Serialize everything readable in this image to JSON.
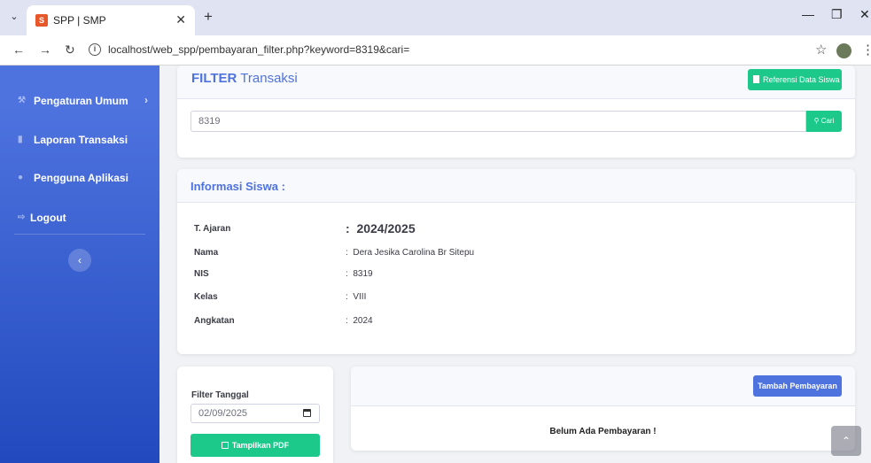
{
  "browser": {
    "tab_title": "SPP | SMP",
    "favicon_text": "S",
    "url": "localhost/web_spp/pembayaran_filter.php?keyword=8319&cari="
  },
  "sidebar": {
    "items": [
      {
        "label": "Pengaturan Umum",
        "icon": "wrench-icon"
      },
      {
        "label": "Laporan Transaksi",
        "icon": "file-icon"
      },
      {
        "label": "Pengguna Aplikasi",
        "icon": "user-icon"
      },
      {
        "label": "Logout",
        "icon": "logout-icon"
      }
    ]
  },
  "filter": {
    "title_bold": "FILTER",
    "title_rest": " Transaksi",
    "reference_button": "Referensi Data Siswa",
    "search_value": "8319",
    "search_button": "Cari"
  },
  "student_info": {
    "title": "Informasi Siswa :",
    "rows": [
      {
        "label": "T. Ajaran",
        "value": "2024/2025"
      },
      {
        "label": "Nama",
        "value": "Dera Jesika Carolina Br Sitepu"
      },
      {
        "label": "NIS",
        "value": "8319"
      },
      {
        "label": "Kelas",
        "value": "VIII"
      },
      {
        "label": "Angkatan",
        "value": "2024"
      }
    ]
  },
  "date_filter": {
    "title": "Filter Tanggal",
    "date_value": "02/09/2025",
    "pdf_button": "Tampilkan PDF"
  },
  "payments": {
    "add_button": "Tambah Pembayaran",
    "empty_message": "Belum Ada Pembayaran !"
  },
  "colors": {
    "primary": "#4e73df",
    "success": "#1cc88a",
    "sidebar_gradient_end": "#224abe"
  }
}
